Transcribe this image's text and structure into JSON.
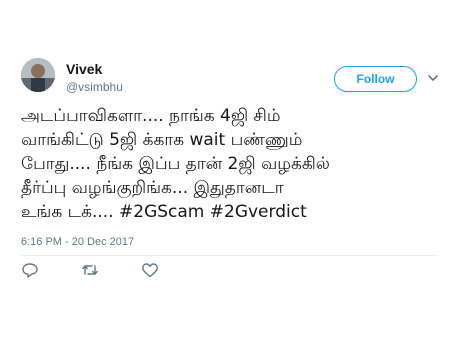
{
  "tweet": {
    "display_name": "Vivek",
    "handle": "@vsimbhu",
    "follow_label": "Follow",
    "text": "அடப்பாவிகளா....  நாங்க 4ஜி சிம்\nவாங்கிட்டு 5ஜி க்காக wait பண்ணும்\nபோது.... நீங்க இப்ப தான் 2ஜி வழக்கில்\nதீர்ப்பு வழங்குறிங்க... இதுதானடா\nஉங்க டக்.... #2GScam #2Gverdict",
    "timestamp": "6:16 PM - 20 Dec 2017"
  },
  "icons": {
    "avatar": "avatar",
    "menu": "chevron-down-icon",
    "reply": "reply-icon",
    "retweet": "retweet-icon",
    "like": "like-icon"
  },
  "colors": {
    "accent": "#1da1f2",
    "text": "#14171a",
    "secondary": "#657786",
    "divider": "#e6ecf0"
  }
}
